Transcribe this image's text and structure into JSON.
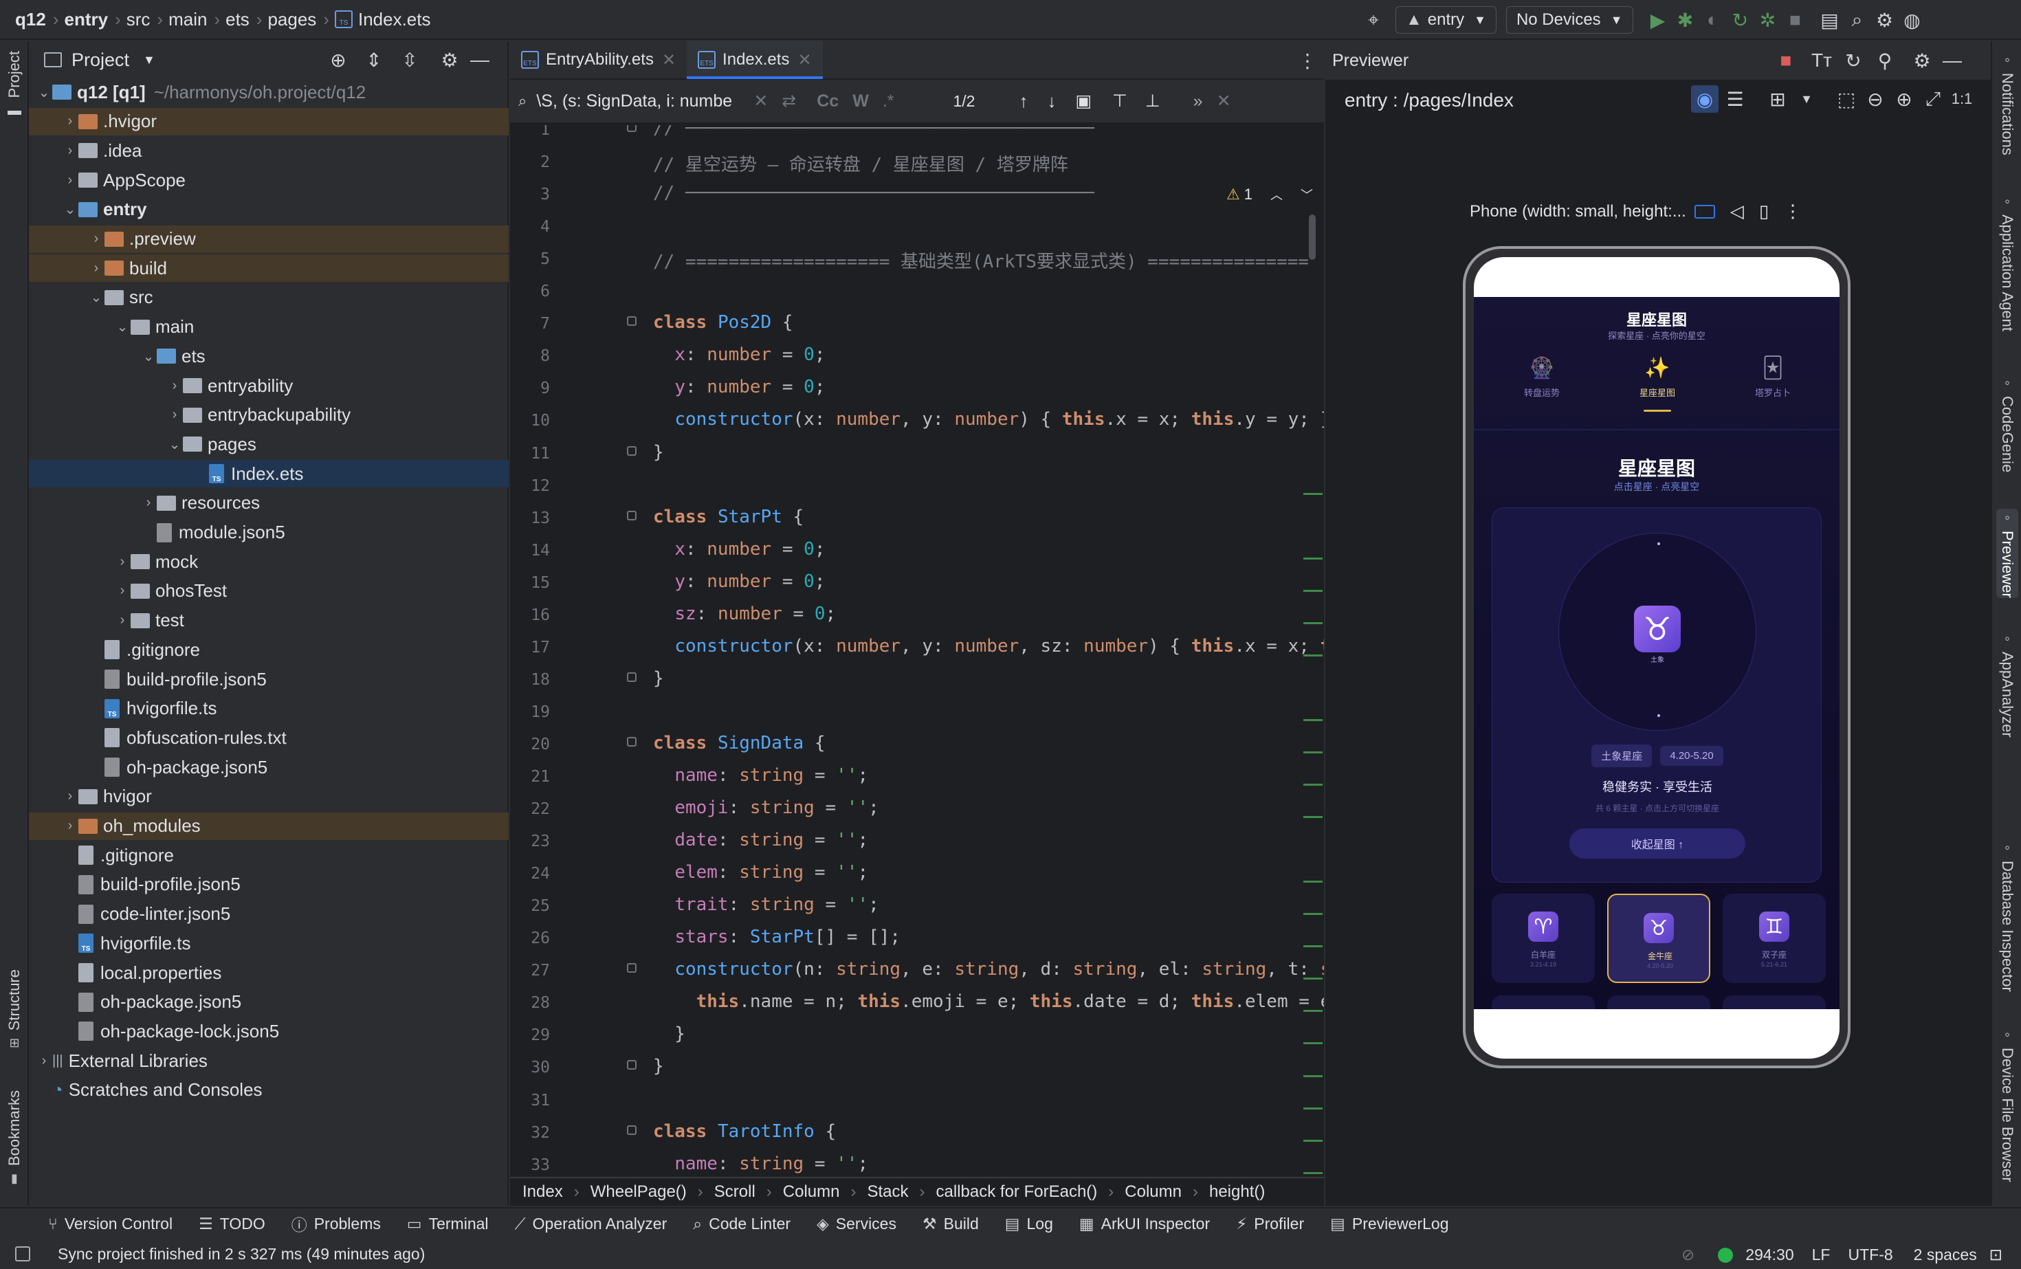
{
  "topbar": {
    "breadcrumb": [
      "q12",
      "entry",
      "src",
      "main",
      "ets",
      "pages",
      "Index.ets"
    ],
    "run_config": "entry",
    "device": "No Devices"
  },
  "left_strip": {
    "project": "Project",
    "structure": "Structure",
    "bookmarks": "Bookmarks"
  },
  "right_strip": [
    "Notifications",
    "Application Agent",
    "CodeGenie",
    "Previewer",
    "AppAnalyzer",
    "Database Inspector",
    "Device File Browser"
  ],
  "project": {
    "title": "Project",
    "tree": [
      {
        "label": "q12 [q1]",
        "suffix": "~/harmonys/oh.project/q12",
        "depth": 0,
        "type": "folder-b",
        "open": true
      },
      {
        "label": ".hvigor",
        "depth": 1,
        "type": "folder-o",
        "open": false,
        "hl": true
      },
      {
        "label": ".idea",
        "depth": 1,
        "type": "folder",
        "open": false
      },
      {
        "label": "AppScope",
        "depth": 1,
        "type": "folder",
        "open": false
      },
      {
        "label": "entry",
        "depth": 1,
        "type": "folder-b",
        "open": true,
        "bold": true
      },
      {
        "label": ".preview",
        "depth": 2,
        "type": "folder-o",
        "open": false,
        "hl": true
      },
      {
        "label": "build",
        "depth": 2,
        "type": "folder-o",
        "open": false,
        "hl": true
      },
      {
        "label": "src",
        "depth": 2,
        "type": "folder",
        "open": true
      },
      {
        "label": "main",
        "depth": 3,
        "type": "folder",
        "open": true
      },
      {
        "label": "ets",
        "depth": 4,
        "type": "folder-b",
        "open": true
      },
      {
        "label": "entryability",
        "depth": 5,
        "type": "folder",
        "open": false
      },
      {
        "label": "entrybackupability",
        "depth": 5,
        "type": "folder",
        "open": false
      },
      {
        "label": "pages",
        "depth": 5,
        "type": "folder",
        "open": true
      },
      {
        "label": "Index.ets",
        "depth": 6,
        "type": "file-ts",
        "sel": true
      },
      {
        "label": "resources",
        "depth": 4,
        "type": "folder",
        "open": false
      },
      {
        "label": "module.json5",
        "depth": 4,
        "type": "file-j"
      },
      {
        "label": "mock",
        "depth": 3,
        "type": "folder",
        "open": false
      },
      {
        "label": "ohosTest",
        "depth": 3,
        "type": "folder",
        "open": false
      },
      {
        "label": "test",
        "depth": 3,
        "type": "folder",
        "open": false
      },
      {
        "label": ".gitignore",
        "depth": 2,
        "type": "file"
      },
      {
        "label": "build-profile.json5",
        "depth": 2,
        "type": "file-j"
      },
      {
        "label": "hvigorfile.ts",
        "depth": 2,
        "type": "file-ts"
      },
      {
        "label": "obfuscation-rules.txt",
        "depth": 2,
        "type": "file"
      },
      {
        "label": "oh-package.json5",
        "depth": 2,
        "type": "file-j"
      },
      {
        "label": "hvigor",
        "depth": 1,
        "type": "folder",
        "open": false
      },
      {
        "label": "oh_modules",
        "depth": 1,
        "type": "folder-o",
        "open": false,
        "hl": true
      },
      {
        "label": ".gitignore",
        "depth": 1,
        "type": "file"
      },
      {
        "label": "build-profile.json5",
        "depth": 1,
        "type": "file-j"
      },
      {
        "label": "code-linter.json5",
        "depth": 1,
        "type": "file-j"
      },
      {
        "label": "hvigorfile.ts",
        "depth": 1,
        "type": "file-ts"
      },
      {
        "label": "local.properties",
        "depth": 1,
        "type": "file"
      },
      {
        "label": "oh-package.json5",
        "depth": 1,
        "type": "file-j"
      },
      {
        "label": "oh-package-lock.json5",
        "depth": 1,
        "type": "file-j"
      },
      {
        "label": "External Libraries",
        "depth": 0,
        "type": "lib",
        "open": false
      },
      {
        "label": "Scratches and Consoles",
        "depth": 0,
        "type": "scratch"
      }
    ]
  },
  "editor": {
    "tabs": [
      {
        "label": "EntryAbility.ets",
        "active": false
      },
      {
        "label": "Index.ets",
        "active": true
      }
    ],
    "search_value": "\\S, (s: SignData, i: numbe",
    "search_count": "1/2",
    "warning_count": "1",
    "lines": [
      {
        "n": "1",
        "h": "<span class='c'>// ──────────────────────────────────────</span>"
      },
      {
        "n": "2",
        "h": "<span class='c'>// 星空运势 — 命运转盘 / 星座星图 / 塔罗牌阵</span>"
      },
      {
        "n": "3",
        "h": "<span class='c'>// ──────────────────────────────────────</span>"
      },
      {
        "n": "4",
        "h": ""
      },
      {
        "n": "5",
        "h": "<span class='c'>// =================== 基础类型(ArkTS要求显式类) ===============</span>"
      },
      {
        "n": "6",
        "h": ""
      },
      {
        "n": "7",
        "h": "<span class='k'>class</span> <span class='cls'>Pos2D</span> {"
      },
      {
        "n": "8",
        "h": "  <span class='pr'>x</span>: <span class='t'>number</span> = <span class='n'>0</span>;"
      },
      {
        "n": "9",
        "h": "  <span class='pr'>y</span>: <span class='t'>number</span> = <span class='n'>0</span>;"
      },
      {
        "n": "10",
        "h": "  <span class='fn'>constructor</span>(x: <span class='t'>number</span>, y: <span class='t'>number</span>) { <span class='k'>this</span>.x = x; <span class='k'>this</span>.y = y; }"
      },
      {
        "n": "11",
        "h": "}"
      },
      {
        "n": "12",
        "h": ""
      },
      {
        "n": "13",
        "h": "<span class='k'>class</span> <span class='cls'>StarPt</span> {"
      },
      {
        "n": "14",
        "h": "  <span class='pr'>x</span>: <span class='t'>number</span> = <span class='n'>0</span>;"
      },
      {
        "n": "15",
        "h": "  <span class='pr'>y</span>: <span class='t'>number</span> = <span class='n'>0</span>;"
      },
      {
        "n": "16",
        "h": "  <span class='pr'>sz</span>: <span class='t'>number</span> = <span class='n'>0</span>;"
      },
      {
        "n": "17",
        "h": "  <span class='fn'>constructor</span>(x: <span class='t'>number</span>, y: <span class='t'>number</span>, sz: <span class='t'>number</span>) { <span class='k'>this</span>.x = x; <span class='k'>t</span>"
      },
      {
        "n": "18",
        "h": "}"
      },
      {
        "n": "19",
        "h": ""
      },
      {
        "n": "20",
        "h": "<span class='k'>class</span> <span class='cls'>SignData</span> {"
      },
      {
        "n": "21",
        "h": "  <span class='pr'>name</span>: <span class='t'>string</span> = <span class='s'>''</span>;"
      },
      {
        "n": "22",
        "h": "  <span class='pr'>emoji</span>: <span class='t'>string</span> = <span class='s'>''</span>;"
      },
      {
        "n": "23",
        "h": "  <span class='pr'>date</span>: <span class='t'>string</span> = <span class='s'>''</span>;"
      },
      {
        "n": "24",
        "h": "  <span class='pr'>elem</span>: <span class='t'>string</span> = <span class='s'>''</span>;"
      },
      {
        "n": "25",
        "h": "  <span class='pr'>trait</span>: <span class='t'>string</span> = <span class='s'>''</span>;"
      },
      {
        "n": "26",
        "h": "  <span class='pr'>stars</span>: <span class='cls'>StarPt</span>[] = [];"
      },
      {
        "n": "27",
        "h": "  <span class='fn'>constructor</span>(n: <span class='t'>string</span>, e: <span class='t'>string</span>, d: <span class='t'>string</span>, el: <span class='t'>string</span>, t: <span class='t'>s</span>"
      },
      {
        "n": "28",
        "h": "    <span class='k'>this</span>.name = n; <span class='k'>this</span>.emoji = e; <span class='k'>this</span>.date = d; <span class='k'>this</span>.elem = e"
      },
      {
        "n": "29",
        "h": "  }"
      },
      {
        "n": "30",
        "h": "}"
      },
      {
        "n": "31",
        "h": ""
      },
      {
        "n": "32",
        "h": "<span class='k'>class</span> <span class='cls'>TarotInfo</span> {"
      },
      {
        "n": "33",
        "h": "  <span class='pr'>name</span>: <span class='t'>string</span> = <span class='s'>''</span>;"
      },
      {
        "n": "34",
        "h": "  <span class='pr'>emoji</span>: <span class='t'>string</span> = <span class='s'>''</span>;"
      }
    ],
    "breadcrumb": [
      "Index",
      "WheelPage()",
      "Scroll",
      "Column",
      "Stack",
      "callback for ForEach()",
      "Column",
      "height()"
    ]
  },
  "previewer": {
    "title": "Previewer",
    "route": "entry : /pages/Index",
    "device_label": "Phone (width: small, height:...",
    "app": {
      "header_title": "星座星图",
      "header_sub": "探索星座 · 点亮你的星空",
      "tabs": [
        {
          "icon": "🎡",
          "label": "转盘运势",
          "active": false
        },
        {
          "icon": "✨",
          "label": "星座星图",
          "active": true
        },
        {
          "icon": "🃏",
          "label": "塔罗占卜",
          "active": false
        }
      ],
      "section_title": "星座星图",
      "section_sub": "点击星座 · 点亮星空",
      "center_sign": "♉",
      "center_elem": "土象",
      "tags": [
        "土象星座",
        "4.20-5.20"
      ],
      "trait": "稳健务实 · 享受生活",
      "hint": "共 6 颗主星 · 点击上方可切换星座",
      "collapse_btn": "收起星图 ↑",
      "signs": [
        {
          "icon": "♈",
          "name": "白羊座",
          "date": "3.21-4.19",
          "active": false
        },
        {
          "icon": "♉",
          "name": "金牛座",
          "date": "4.20-5.20",
          "active": true
        },
        {
          "icon": "♊",
          "name": "双子座",
          "date": "5.21-6.21",
          "active": false
        },
        {
          "icon": "♋",
          "name": "",
          "date": "",
          "active": false
        },
        {
          "icon": "♌",
          "name": "",
          "date": "",
          "active": false
        },
        {
          "icon": "♍",
          "name": "",
          "date": "",
          "active": false
        }
      ]
    }
  },
  "bottom_tools": [
    "Version Control",
    "TODO",
    "Problems",
    "Terminal",
    "Operation Analyzer",
    "Code Linter",
    "Services",
    "Build",
    "Log",
    "ArkUI Inspector",
    "Profiler",
    "PreviewerLog"
  ],
  "status": {
    "message": "Sync project finished in 2 s 327 ms (49 minutes ago)",
    "position": "294:30",
    "line_sep": "LF",
    "encoding": "UTF-8",
    "indent": "2 spaces"
  },
  "colors": {
    "accent": "#3574f0",
    "app_bg": "#120f30",
    "gold": "#e2b64a",
    "purple": "#7b5ae0"
  }
}
